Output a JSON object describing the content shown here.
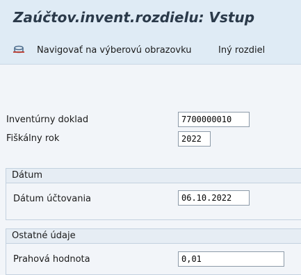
{
  "title": "Zaúčtov.invent.rozdielu: Vstup",
  "toolbar": {
    "navigate_icon": "database-icon",
    "navigate_label": "Navigovať na výberovú obrazovku",
    "other_diff_label": "Iný rozdiel"
  },
  "fields": {
    "inventory_doc_label": "Inventúrny doklad",
    "inventory_doc_value": "7700000010",
    "fiscal_year_label": "Fiškálny rok",
    "fiscal_year_value": "2022"
  },
  "date_group": {
    "title": "Dátum",
    "posting_date_label": "Dátum účtovania",
    "posting_date_value": "06.10.2022"
  },
  "other_group": {
    "title": "Ostatné údaje",
    "threshold_label": "Prahová hodnota",
    "threshold_value": "0,01"
  }
}
